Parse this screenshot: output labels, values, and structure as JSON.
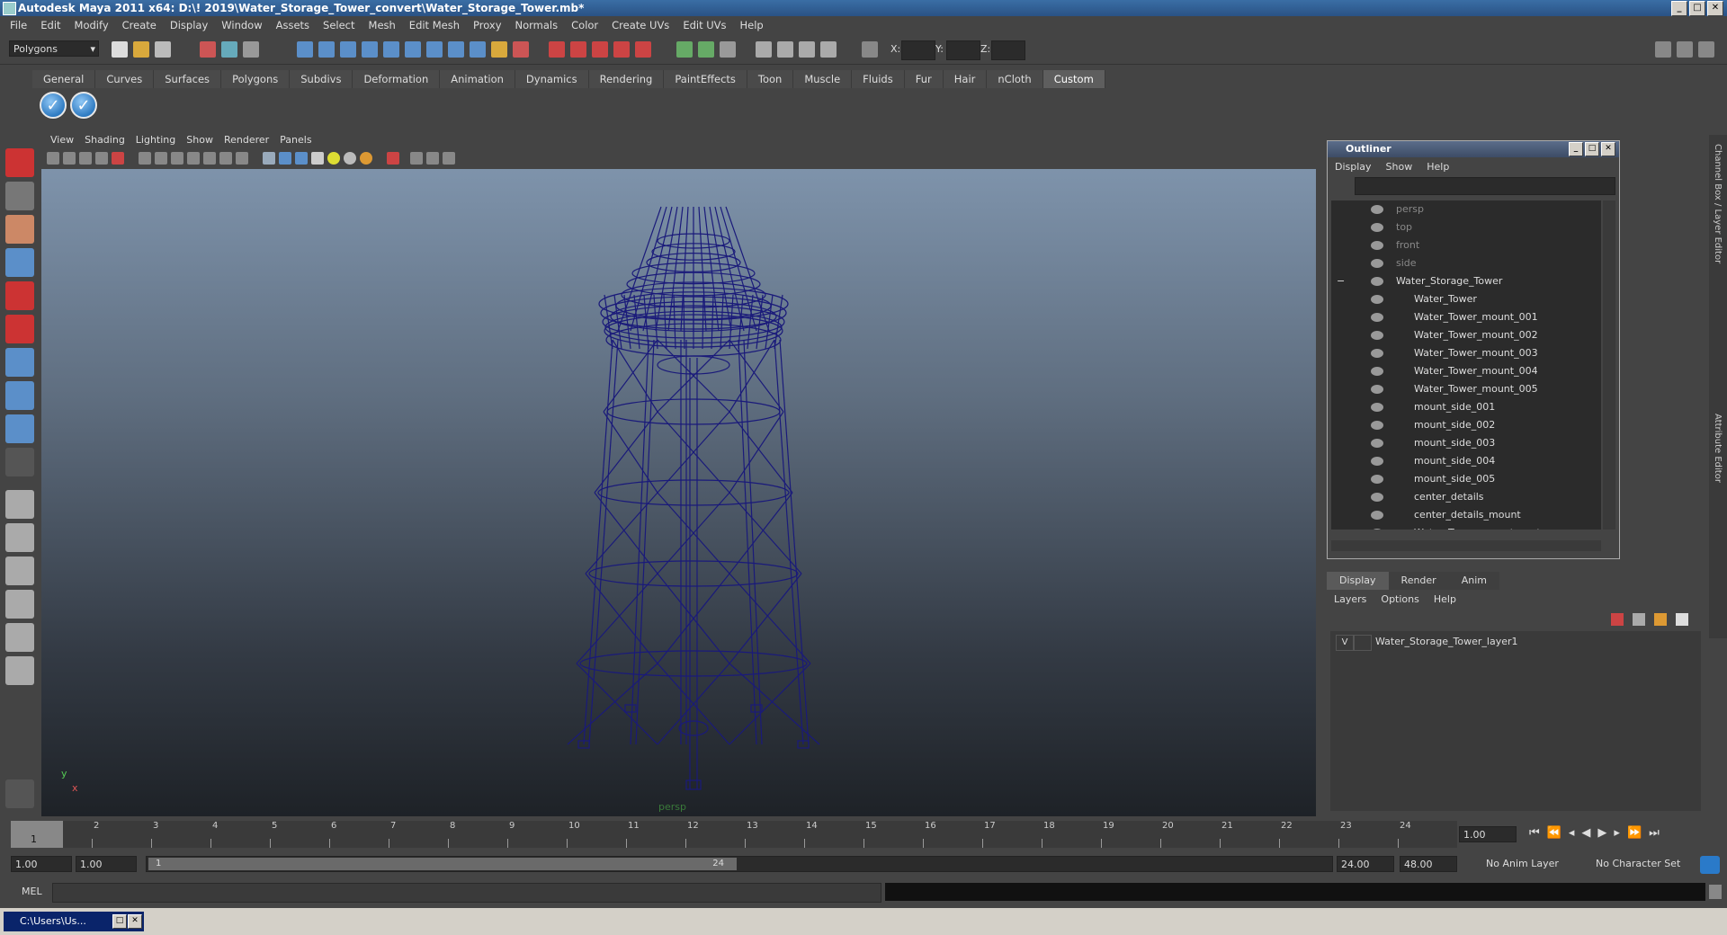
{
  "window": {
    "title": "Autodesk Maya 2011 x64: D:\\! 2019\\Water_Storage_Tower_convert\\Water_Storage_Tower.mb*"
  },
  "menubar": [
    "File",
    "Edit",
    "Modify",
    "Create",
    "Display",
    "Window",
    "Assets",
    "Select",
    "Mesh",
    "Edit Mesh",
    "Proxy",
    "Normals",
    "Color",
    "Create UVs",
    "Edit UVs",
    "Help"
  ],
  "toolbar": {
    "mode": "Polygons",
    "x_label": "X:",
    "y_label": "Y:",
    "z_label": "Z:"
  },
  "shelf": {
    "tabs": [
      "General",
      "Curves",
      "Surfaces",
      "Polygons",
      "Subdivs",
      "Deformation",
      "Animation",
      "Dynamics",
      "Rendering",
      "PaintEffects",
      "Toon",
      "Muscle",
      "Fluids",
      "Fur",
      "Hair",
      "nCloth",
      "Custom"
    ],
    "active_tab": "Custom",
    "buttons": [
      "check-icon",
      "check-icon"
    ]
  },
  "viewport": {
    "menu": [
      "View",
      "Shading",
      "Lighting",
      "Show",
      "Renderer",
      "Panels"
    ],
    "camera_label": "persp",
    "axis": {
      "y": "y",
      "x": "x"
    },
    "wire_color": "#1a1a7a"
  },
  "outliner": {
    "title": "Outliner",
    "menu": [
      "Display",
      "Show",
      "Help"
    ],
    "items": [
      {
        "label": "persp",
        "type": "camera"
      },
      {
        "label": "top",
        "type": "camera"
      },
      {
        "label": "front",
        "type": "camera"
      },
      {
        "label": "side",
        "type": "camera"
      },
      {
        "label": "Water_Storage_Tower",
        "type": "group"
      },
      {
        "label": "Water_Tower",
        "type": "mesh"
      },
      {
        "label": "Water_Tower_mount_001",
        "type": "mesh"
      },
      {
        "label": "Water_Tower_mount_002",
        "type": "mesh"
      },
      {
        "label": "Water_Tower_mount_003",
        "type": "mesh"
      },
      {
        "label": "Water_Tower_mount_004",
        "type": "mesh"
      },
      {
        "label": "Water_Tower_mount_005",
        "type": "mesh"
      },
      {
        "label": "mount_side_001",
        "type": "mesh"
      },
      {
        "label": "mount_side_002",
        "type": "mesh"
      },
      {
        "label": "mount_side_003",
        "type": "mesh"
      },
      {
        "label": "mount_side_004",
        "type": "mesh"
      },
      {
        "label": "mount_side_005",
        "type": "mesh"
      },
      {
        "label": "center_details",
        "type": "mesh"
      },
      {
        "label": "center_details_mount",
        "type": "mesh"
      },
      {
        "label": "Water_Tower_mount_center",
        "type": "mesh"
      }
    ]
  },
  "side_tabs": [
    "Channel Box / Layer Editor",
    "Attribute Editor"
  ],
  "layer_editor": {
    "tabs": [
      "Display",
      "Render",
      "Anim"
    ],
    "active_tab": "Display",
    "menu": [
      "Layers",
      "Options",
      "Help"
    ],
    "layers": [
      {
        "visible": "V",
        "name": "Water_Storage_Tower_layer1"
      }
    ]
  },
  "timeline": {
    "frames": [
      "1",
      "2",
      "3",
      "4",
      "5",
      "6",
      "7",
      "8",
      "9",
      "10",
      "11",
      "12",
      "13",
      "14",
      "15",
      "16",
      "17",
      "18",
      "19",
      "20",
      "21",
      "22",
      "23",
      "24"
    ],
    "current_frame_label": "1",
    "current_time": "1.00"
  },
  "range": {
    "start": "1.00",
    "playback_start": "1.00",
    "slider_start": "1",
    "slider_end": "24",
    "playback_end": "24.00",
    "end": "48.00",
    "anim_layer": "No Anim Layer",
    "character_set": "No Character Set"
  },
  "command_line": {
    "label": "MEL"
  },
  "taskbar": {
    "item": "C:\\Users\\Us..."
  }
}
